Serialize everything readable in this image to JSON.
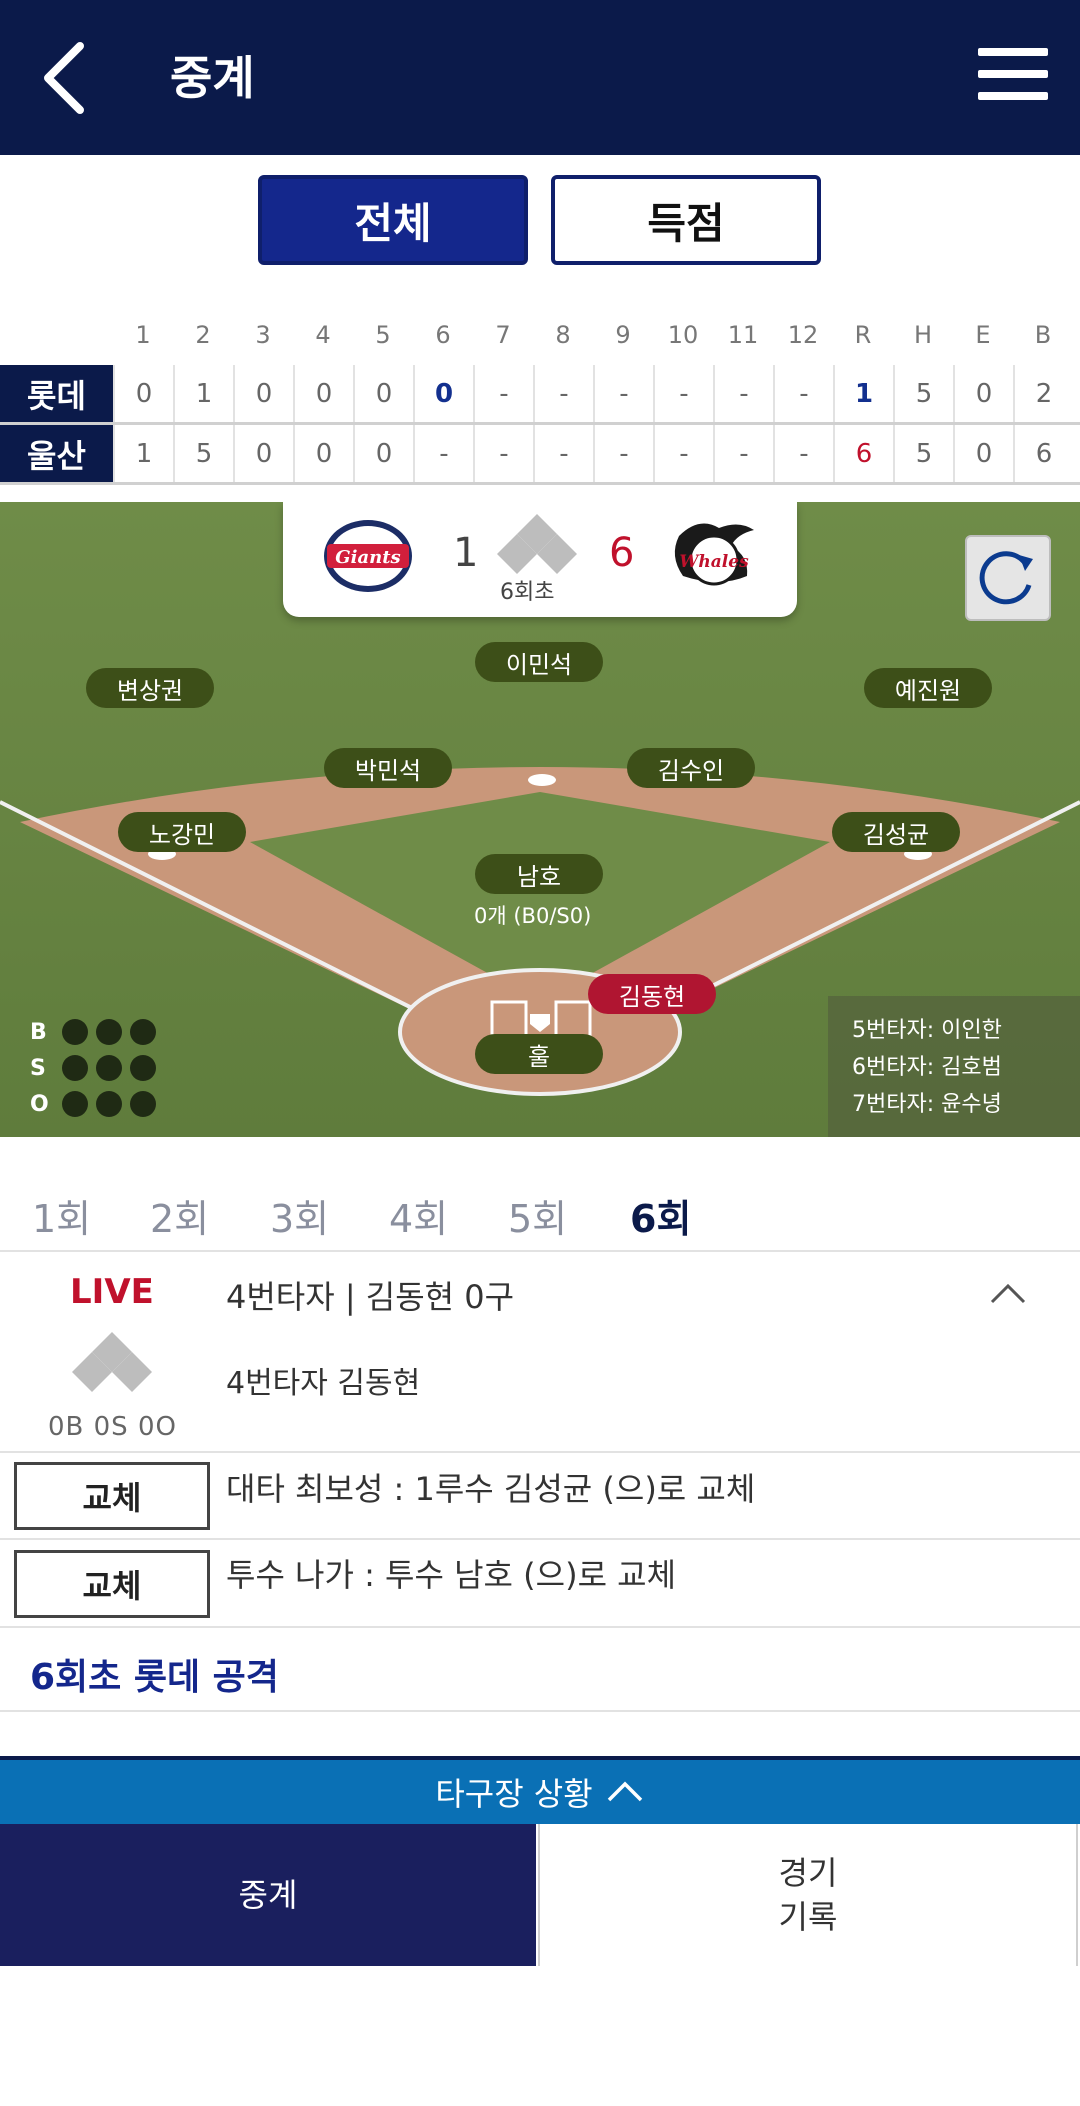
{
  "header": {
    "title": "중계"
  },
  "toggle": {
    "all": "전체",
    "score": "득점"
  },
  "scoreboard": {
    "columns": [
      "1",
      "2",
      "3",
      "4",
      "5",
      "6",
      "7",
      "8",
      "9",
      "10",
      "11",
      "12",
      "R",
      "H",
      "E",
      "B"
    ],
    "teams": [
      {
        "name": "롯데",
        "cells": [
          "0",
          "1",
          "0",
          "0",
          "0",
          "0",
          "-",
          "-",
          "-",
          "-",
          "-",
          "-",
          "1",
          "5",
          "0",
          "2"
        ]
      },
      {
        "name": "울산",
        "cells": [
          "1",
          "5",
          "0",
          "0",
          "0",
          "-",
          "-",
          "-",
          "-",
          "-",
          "-",
          "-",
          "6",
          "5",
          "0",
          "6"
        ]
      }
    ]
  },
  "game": {
    "away_score": "1",
    "home_score": "6",
    "inning": "6회초",
    "pitch_count": "0개 (B0/S0)",
    "bso_labels": [
      "B",
      "S",
      "O"
    ]
  },
  "fielders": {
    "lf": "변상권",
    "cf": "이민석",
    "rf": "예진원",
    "ss": "박민석",
    "second": "김수인",
    "third": "노강민",
    "first": "김성균",
    "pitcher": "남호",
    "batter": "김동현",
    "catcher": "훌"
  },
  "next_batters": [
    "5번타자: 이인한",
    "6번타자: 김호범",
    "7번타자: 윤수녕"
  ],
  "innings": [
    "1회",
    "2회",
    "3회",
    "4회",
    "5회",
    "6회"
  ],
  "log": {
    "live": "LIVE",
    "title": "4번타자 | 김동현 0구",
    "sub": "4번타자 김동현",
    "count": "0B 0S 0O",
    "entries": [
      {
        "badge": "교체",
        "text": "대타 최보성 : 1루수 김성균 (으)로 교체"
      },
      {
        "badge": "교체",
        "text": "투수 나가 : 투수 남호 (으)로 교체"
      }
    ],
    "attack": "6회초 롯데 공격"
  },
  "bottom": {
    "other_stadium": "타구장 상황",
    "tab_broadcast": "중계",
    "tab_record_1": "경기",
    "tab_record_2": "기록"
  },
  "logos": {
    "away_text": "Giants",
    "home_text": "Whales"
  },
  "colors": {
    "navy": "#0b1a4a",
    "active_blue": "#14278c",
    "live_red": "#c0112c",
    "field_green": "#6d8a45",
    "infield_dirt": "#c9977a"
  }
}
